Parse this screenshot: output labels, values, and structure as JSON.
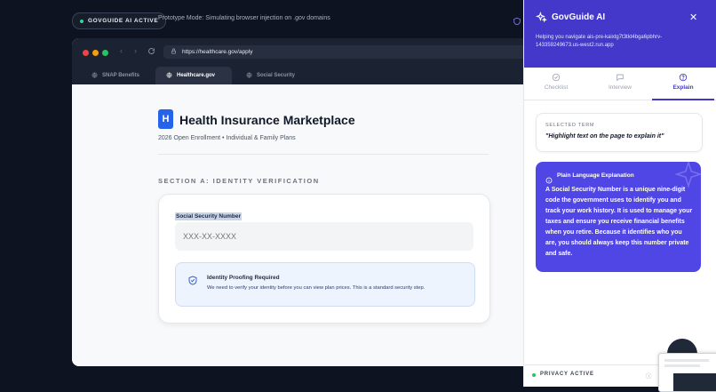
{
  "topbar": {
    "badge": "GOVGUIDE AI ACTIVE",
    "prototype_text": "Prototype Mode: Simulating browser injection on .gov domains"
  },
  "browser": {
    "url": "https://healthcare.gov/apply",
    "tabs": [
      {
        "label": "SNAP Benefits",
        "icon": "globe-icon",
        "active": false
      },
      {
        "label": "Healthcare.gov",
        "icon": "globe-icon",
        "active": true
      },
      {
        "label": "Social Security",
        "icon": "globe-icon",
        "active": false
      }
    ]
  },
  "page": {
    "logo_letter": "H",
    "title": "Health Insurance Marketplace",
    "subtitle": "2026 Open Enrollment • Individual & Family Plans",
    "section_title": "SECTION A: IDENTITY VERIFICATION",
    "ssn_label": "Social Security Number",
    "ssn_placeholder": "XXX-XX-XXXX",
    "notice_title": "Identity Proofing Required",
    "notice_text": "We need to verify your identity before you can view plan prices. This is a standard security step."
  },
  "panel": {
    "title": "GovGuide AI",
    "subtitle": "Helping you navigate ais-pre-kaixtg7t3tkt4bga6pbhrv-143359249673.us-west2.run.app",
    "tabs": [
      {
        "label": "Checklist",
        "icon": "checklist-icon",
        "active": false
      },
      {
        "label": "Interview",
        "icon": "chat-icon",
        "active": false
      },
      {
        "label": "Explain",
        "icon": "help-icon",
        "active": true
      }
    ],
    "selected_term_header": "SELECTED TERM",
    "selected_term_value": "\"Highlight text on the page to explain it\"",
    "explanation_header": "Plain Language Explanation",
    "explanation_text": "A Social Security Number is a unique nine-digit code the government uses to identify you and track your work history. It is used to manage your taxes and ensure you receive financial benefits when you retire. Because it identifies who you are, you should always keep this number private and safe.",
    "footer_status": "PRIVACY ACTIVE"
  },
  "colors": {
    "accent": "#4338ca",
    "explain_card": "#4f46e5",
    "status_green": "#22c55e",
    "page_blue": "#2563eb"
  }
}
